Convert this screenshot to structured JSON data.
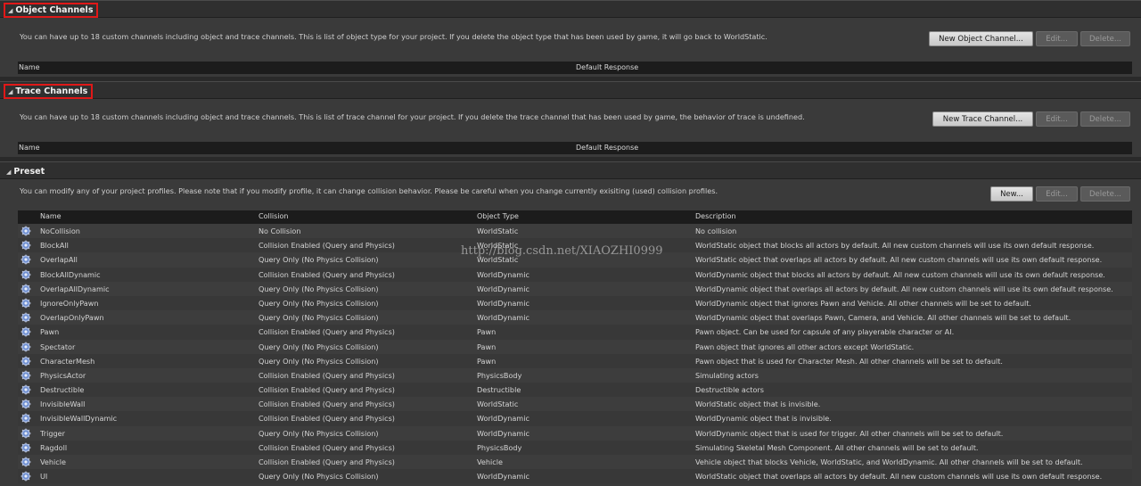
{
  "object_channels": {
    "title": "Object Channels",
    "description": "You can have up to 18 custom channels including object and trace channels. This is list of object type for your project. If you delete the object type that has been used by game, it will go back to WorldStatic.",
    "new_button": "New Object Channel...",
    "edit_button": "Edit...",
    "delete_button": "Delete...",
    "columns": [
      "Name",
      "Default Response"
    ]
  },
  "trace_channels": {
    "title": "Trace Channels",
    "description": "You can have up to 18 custom channels including object and trace channels. This is list of trace channel for your project. If you delete the trace channel that has been used by game, the behavior of trace is undefined.",
    "new_button": "New Trace Channel...",
    "edit_button": "Edit...",
    "delete_button": "Delete...",
    "columns": [
      "Name",
      "Default Response"
    ]
  },
  "preset": {
    "title": "Preset",
    "description": "You can modify any of your project profiles. Please note that if you modify profile, it can change collision behavior. Please be careful when you change currently exisiting (used) collision profiles.",
    "new_button": "New...",
    "edit_button": "Edit...",
    "delete_button": "Delete...",
    "columns": [
      "Name",
      "Collision",
      "Object Type",
      "Description"
    ],
    "rows": [
      {
        "name": "NoCollision",
        "collision": "No Collision",
        "object_type": "WorldStatic",
        "description": "No collision"
      },
      {
        "name": "BlockAll",
        "collision": "Collision Enabled (Query and Physics)",
        "object_type": "WorldStatic",
        "description": "WorldStatic object that blocks all actors by default. All new custom channels will use its own default response."
      },
      {
        "name": "OverlapAll",
        "collision": "Query Only (No Physics Collision)",
        "object_type": "WorldStatic",
        "description": "WorldStatic object that overlaps all actors by default. All new custom channels will use its own default response."
      },
      {
        "name": "BlockAllDynamic",
        "collision": "Collision Enabled (Query and Physics)",
        "object_type": "WorldDynamic",
        "description": "WorldDynamic object that blocks all actors by default. All new custom channels will use its own default response."
      },
      {
        "name": "OverlapAllDynamic",
        "collision": "Query Only (No Physics Collision)",
        "object_type": "WorldDynamic",
        "description": "WorldDynamic object that overlaps all actors by default. All new custom channels will use its own default response."
      },
      {
        "name": "IgnoreOnlyPawn",
        "collision": "Query Only (No Physics Collision)",
        "object_type": "WorldDynamic",
        "description": "WorldDynamic object that ignores Pawn and Vehicle. All other channels will be set to default."
      },
      {
        "name": "OverlapOnlyPawn",
        "collision": "Query Only (No Physics Collision)",
        "object_type": "WorldDynamic",
        "description": "WorldDynamic object that overlaps Pawn, Camera, and Vehicle. All other channels will be set to default."
      },
      {
        "name": "Pawn",
        "collision": "Collision Enabled (Query and Physics)",
        "object_type": "Pawn",
        "description": "Pawn object. Can be used for capsule of any playerable character or AI."
      },
      {
        "name": "Spectator",
        "collision": "Query Only (No Physics Collision)",
        "object_type": "Pawn",
        "description": "Pawn object that ignores all other actors except WorldStatic."
      },
      {
        "name": "CharacterMesh",
        "collision": "Query Only (No Physics Collision)",
        "object_type": "Pawn",
        "description": "Pawn object that is used for Character Mesh. All other channels will be set to default."
      },
      {
        "name": "PhysicsActor",
        "collision": "Collision Enabled (Query and Physics)",
        "object_type": "PhysicsBody",
        "description": "Simulating actors"
      },
      {
        "name": "Destructible",
        "collision": "Collision Enabled (Query and Physics)",
        "object_type": "Destructible",
        "description": "Destructible actors"
      },
      {
        "name": "InvisibleWall",
        "collision": "Collision Enabled (Query and Physics)",
        "object_type": "WorldStatic",
        "description": "WorldStatic object that is invisible."
      },
      {
        "name": "InvisibleWallDynamic",
        "collision": "Collision Enabled (Query and Physics)",
        "object_type": "WorldDynamic",
        "description": "WorldDynamic object that is invisible."
      },
      {
        "name": "Trigger",
        "collision": "Query Only (No Physics Collision)",
        "object_type": "WorldDynamic",
        "description": "WorldDynamic object that is used for trigger. All other channels will be set to default."
      },
      {
        "name": "Ragdoll",
        "collision": "Collision Enabled (Query and Physics)",
        "object_type": "PhysicsBody",
        "description": "Simulating Skeletal Mesh Component. All other channels will be set to default."
      },
      {
        "name": "Vehicle",
        "collision": "Collision Enabled (Query and Physics)",
        "object_type": "Vehicle",
        "description": "Vehicle object that blocks Vehicle, WorldStatic, and WorldDynamic. All other channels will be set to default."
      },
      {
        "name": "UI",
        "collision": "Query Only (No Physics Collision)",
        "object_type": "WorldDynamic",
        "description": "WorldStatic object that overlaps all actors by default. All new custom channels will use its own default response."
      }
    ]
  },
  "watermark": "http://blog.csdn.net/XIAOZHI0999",
  "icons": {
    "row_icon": "profile-gear-icon",
    "collapse": "collapse-triangle-icon"
  },
  "colors": {
    "highlight_box": "#e01818",
    "background": "#3a3a3a",
    "header_bar": "#1c1c1c"
  }
}
